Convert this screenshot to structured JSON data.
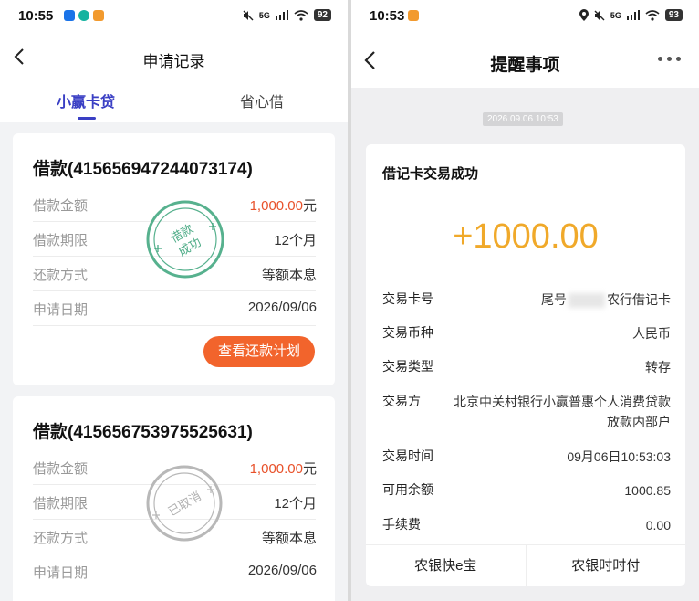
{
  "left": {
    "status": {
      "time": "10:55",
      "battery": "92",
      "signal": "5G"
    },
    "nav": {
      "title": "申请记录"
    },
    "tabs": [
      {
        "label": "小赢卡贷"
      },
      {
        "label": "省心借"
      }
    ],
    "cards": [
      {
        "title": "借款(415656947244073174)",
        "rows": [
          {
            "label": "借款金额",
            "value": "1,000.00",
            "unit": "元"
          },
          {
            "label": "借款期限",
            "value": "12个月"
          },
          {
            "label": "还款方式",
            "value": "等额本息"
          },
          {
            "label": "申请日期",
            "value": "2026/09/06"
          }
        ],
        "stamp": {
          "text": "借款成功",
          "color": "#3aa37a"
        },
        "button": "查看还款计划"
      },
      {
        "title": "借款(415656753975525631)",
        "rows": [
          {
            "label": "借款金额",
            "value": "1,000.00",
            "unit": "元"
          },
          {
            "label": "借款期限",
            "value": "12个月"
          },
          {
            "label": "还款方式",
            "value": "等额本息"
          },
          {
            "label": "申请日期",
            "value": "2026/09/06"
          }
        ],
        "stamp": {
          "text": "已取消",
          "color": "#b5b5b5"
        }
      }
    ]
  },
  "right": {
    "status": {
      "time": "10:53",
      "battery": "93",
      "signal": "5G"
    },
    "nav": {
      "title": "提醒事项"
    },
    "timestamp": "2026.09.06 10:53",
    "message": {
      "title": "借记卡交易成功",
      "amount": "+1000.00",
      "rows": [
        {
          "label": "交易卡号",
          "value_prefix": "尾号",
          "value_suffix": "农行借记卡"
        },
        {
          "label": "交易币种",
          "value": "人民币"
        },
        {
          "label": "交易类型",
          "value": "转存"
        },
        {
          "label": "交易方",
          "value": "北京中关村银行小赢普惠个人消费贷款",
          "value2": "放款内部户"
        },
        {
          "label": "交易时间",
          "value": "09月06日10:53:03"
        },
        {
          "label": "可用余额",
          "value": "1000.85"
        },
        {
          "label": "手续费",
          "value": "0.00"
        }
      ],
      "actions": [
        "农银快e宝",
        "农银时时付"
      ]
    }
  },
  "colors": {
    "accent": "#3a3fc4",
    "orange": "#f2642c",
    "gold": "#f0a92a",
    "success_stamp": "#3aa37a"
  }
}
